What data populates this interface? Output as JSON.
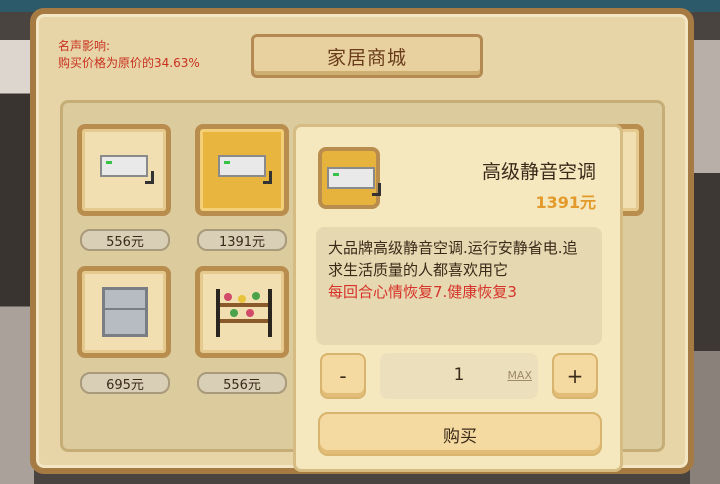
{
  "reputation": {
    "label": "名声影响:",
    "effect": "购买价格为原价的34.63%"
  },
  "shop": {
    "title": "家居商城",
    "items": [
      {
        "icon": "air-conditioner-icon",
        "price": "556元",
        "selected": false
      },
      {
        "icon": "air-conditioner-icon",
        "price": "1391元",
        "selected": true
      },
      {
        "icon": "refrigerator-icon",
        "price": "695元",
        "selected": false
      },
      {
        "icon": "flower-rack-icon",
        "price": "556元",
        "selected": false
      }
    ]
  },
  "detail": {
    "name": "高级静音空调",
    "price": "1391元",
    "description": "大品牌高级静音空调.运行安静省电.追求生活质量的人都喜欢用它",
    "effect": "每回合心情恢复7.健康恢复3",
    "quantity": "1",
    "minus_label": "-",
    "plus_label": "+",
    "max_label": "MAX",
    "buy_label": "购买"
  },
  "colors": {
    "panel": "#e7d5a8",
    "border": "#a67a43",
    "selected": "#e8b53f",
    "price_accent": "#e39a2a",
    "effect_text": "#d6322a"
  }
}
